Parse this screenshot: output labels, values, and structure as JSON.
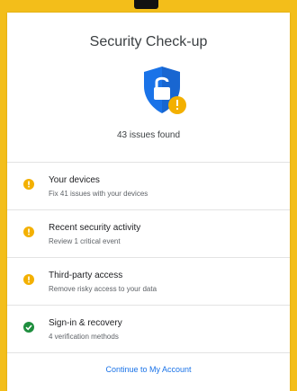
{
  "colors": {
    "frame": "#f3be1a",
    "shield": "#1a73e8",
    "warning": "#f3b000",
    "success": "#1e8e3e",
    "link": "#1a73e8"
  },
  "header": {
    "title": "Security Check-up",
    "issues_summary": "43 issues found",
    "icon": "shield-unlock-warning-icon"
  },
  "items": [
    {
      "title": "Your devices",
      "subtitle": "Fix 41 issues with your devices",
      "status": "warning"
    },
    {
      "title": "Recent security activity",
      "subtitle": "Review 1 critical event",
      "status": "warning"
    },
    {
      "title": "Third-party access",
      "subtitle": "Remove risky access to your data",
      "status": "warning"
    },
    {
      "title": "Sign-in & recovery",
      "subtitle": "4 verification methods",
      "status": "ok"
    }
  ],
  "footer": {
    "link_label": "Continue to My Account"
  }
}
